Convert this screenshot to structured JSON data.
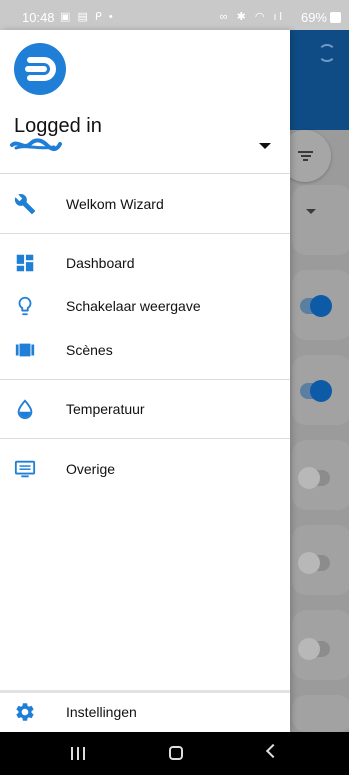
{
  "status_bar": {
    "time": "10:48",
    "left_icons": "▣ ▤ ᑭ •",
    "right_icons": "∞ ✱ ◠ ıl",
    "battery": "69%"
  },
  "drawer": {
    "account": {
      "title": "Logged in"
    },
    "items": [
      {
        "label": "Welkom Wizard",
        "icon": "wrench-icon"
      },
      {
        "label": "Dashboard",
        "icon": "dashboard-icon"
      },
      {
        "label": "Schakelaar weergave",
        "icon": "lightbulb-icon"
      },
      {
        "label": "Scènes",
        "icon": "scenes-icon"
      },
      {
        "label": "Temperatuur",
        "icon": "water-drop-icon"
      },
      {
        "label": "Overige",
        "icon": "monitor-icon"
      }
    ],
    "footer": {
      "label": "Instellingen",
      "icon": "gear-icon"
    }
  },
  "background_app": {
    "toggles": [
      true,
      true,
      false,
      false,
      false
    ]
  },
  "colors": {
    "accent": "#1f7fd6",
    "header": "#0f4c85"
  }
}
